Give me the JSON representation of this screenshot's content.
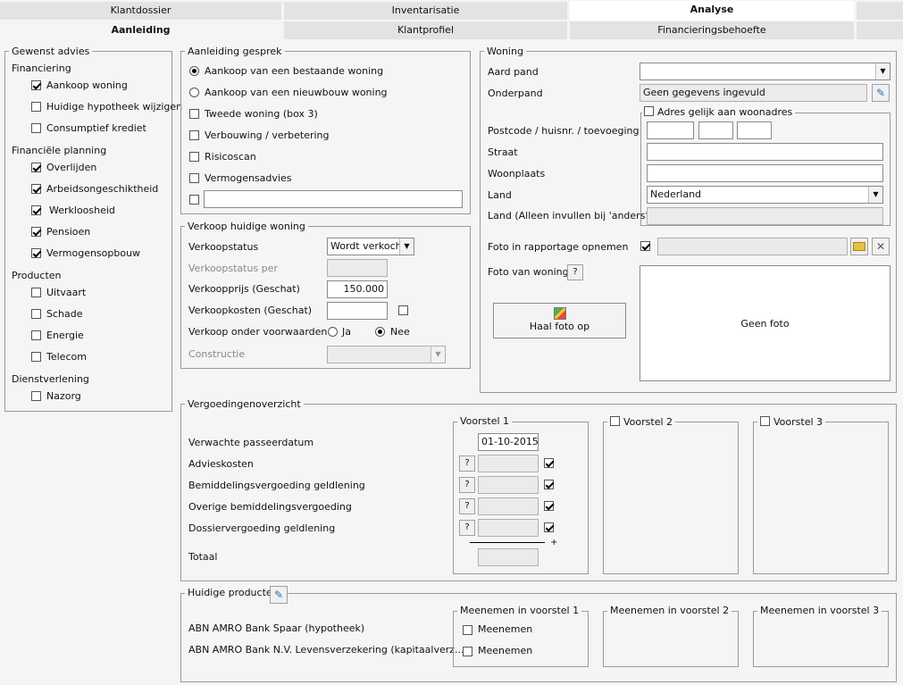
{
  "tabs": {
    "top": [
      "Klantdossier",
      "Inventarisatie",
      "Analyse"
    ],
    "sub": [
      "Aanleiding",
      "Klantprofiel",
      "Financieringsbehoefte"
    ]
  },
  "gewenst": {
    "title": "Gewenst advies",
    "g1": "Financiering",
    "i1": "Aankoop woning",
    "i2": "Huidige hypotheek wijzigen",
    "i3": "Consumptief krediet",
    "g2": "Financiële planning",
    "i4": "Overlijden",
    "i5": "Arbeidsongeschiktheid",
    "i6": "Werkloosheid",
    "i7": "Pensioen",
    "i8": "Vermogensopbouw",
    "g3": "Producten",
    "i9": "Uitvaart",
    "i10": "Schade",
    "i11": "Energie",
    "i12": "Telecom",
    "g4": "Dienstverlening",
    "i13": "Nazorg"
  },
  "aanleiding": {
    "title": "Aanleiding gesprek",
    "r1": "Aankoop van een bestaande woning",
    "r2": "Aankoop van een nieuwbouw woning",
    "c1": "Tweede woning (box 3)",
    "c2": "Verbouwing / verbetering",
    "c3": "Risicoscan",
    "c4": "Vermogensadvies",
    "other": ""
  },
  "verkoop": {
    "title": "Verkoop huidige woning",
    "status_label": "Verkoopstatus",
    "status_value": "Wordt verkocht",
    "per_label": "Verkoopstatus per",
    "per_value": "",
    "prijs_label": "Verkoopprijs (Geschat)",
    "prijs_value": "150.000",
    "kosten_label": "Verkoopkosten (Geschat)",
    "kosten_value": "",
    "voorwaarden_label": "Verkoop onder voorwaarden",
    "ja": "Ja",
    "nee": "Nee",
    "constructie_label": "Constructie",
    "constructie_value": ""
  },
  "woning": {
    "title": "Woning",
    "aard_label": "Aard pand",
    "aard_value": "",
    "onderpand_label": "Onderpand",
    "onderpand_value": "Geen gegevens ingevuld",
    "adres_gelijk": "Adres gelijk aan woonadres",
    "postcode_label": "Postcode / huisnr. / toevoeging",
    "straat_label": "Straat",
    "woonplaats_label": "Woonplaats",
    "land_label": "Land",
    "land_value": "Nederland",
    "land_anders_label": "Land (Alleen invullen bij 'anders')",
    "foto_rapport_label": "Foto in rapportage opnemen",
    "foto_label": "Foto van woning",
    "q": "?",
    "haal_foto": "Haal foto op",
    "geen_foto": "Geen foto"
  },
  "vergoeding": {
    "title": "Vergoedingenoverzicht",
    "v1": "Voorstel 1",
    "v2": "Voorstel 2",
    "v3": "Voorstel 3",
    "datum_label": "Verwachte passeerdatum",
    "datum_value": "01-10-2015",
    "r1": "Advieskosten",
    "r2": "Bemiddelingsvergoeding geldlening",
    "r3": "Overige bemiddelingsvergoeding",
    "r4": "Dossiervergoeding geldlening",
    "totaal": "Totaal",
    "plus": "+",
    "q": "?"
  },
  "producten": {
    "title": "Huidige producten",
    "p1": "ABN AMRO Bank Spaar (hypotheek)",
    "p2": "ABN AMRO Bank N.V. Levensverzekering (kapitaalverz...",
    "m1": "Meenemen in voorstel 1",
    "m2": "Meenemen in voorstel 2",
    "m3": "Meenemen in voorstel 3",
    "meenemen": "Meenemen"
  }
}
